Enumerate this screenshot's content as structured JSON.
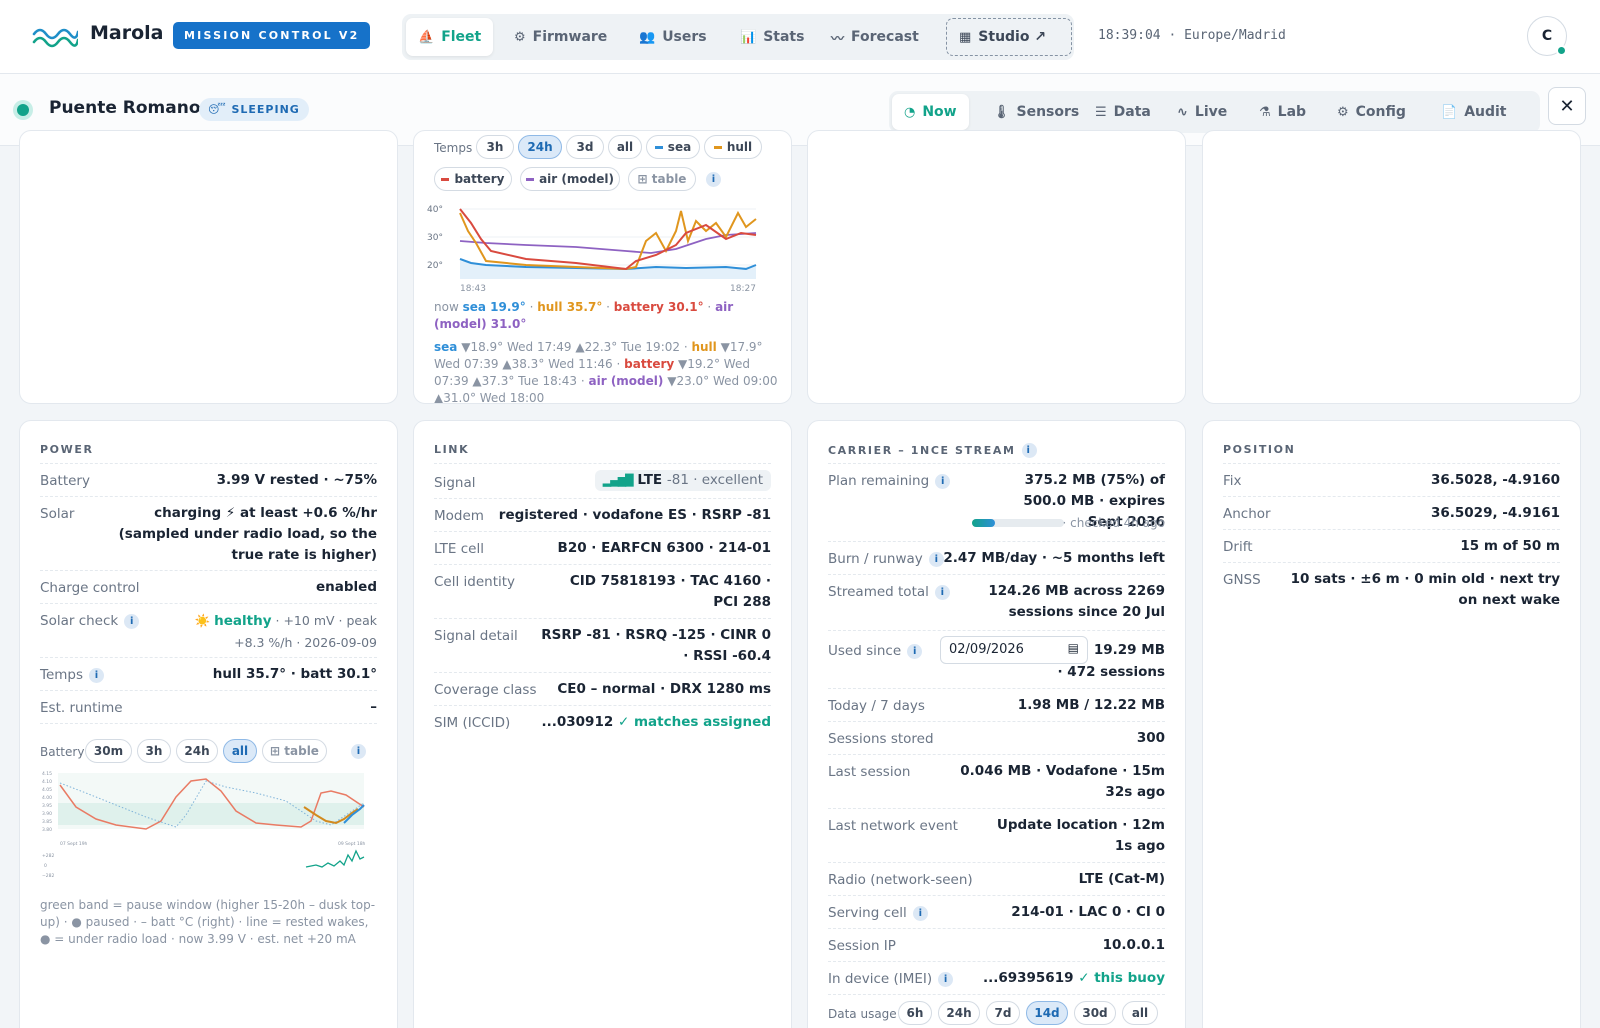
{
  "app": {
    "brand": "Marola",
    "badge": "MISSION CONTROL V2",
    "clock": "18:39:04 · Europe/Madrid",
    "avatar": "C"
  },
  "nav": {
    "fleet": "Fleet",
    "firmware": "Firmware",
    "users": "Users",
    "stats": "Stats",
    "forecast": "Forecast",
    "studio": "Studio ↗"
  },
  "site": {
    "name": "Puente Romano",
    "status": "😴 SLEEPING"
  },
  "tabs": {
    "now": "Now",
    "sensors": "Sensors",
    "data": "Data",
    "live": "Live",
    "lab": "Lab",
    "config": "Config",
    "audit": "Audit"
  },
  "temps": {
    "label": "Temps",
    "ranges": [
      "3h",
      "24h",
      "3d",
      "all"
    ],
    "active": "24h",
    "legend": {
      "sea": "sea",
      "hull": "hull",
      "battery": "battery",
      "air": "air (model)",
      "table": "⊞ table"
    },
    "yticks": [
      "40°",
      "30°",
      "20°"
    ],
    "xticks": [
      "18:43",
      "18:27"
    ],
    "now": {
      "prefix": "now",
      "sea": "sea 19.9°",
      "hull": "hull 35.7°",
      "battery": "battery 30.1°",
      "air": "air (model) 31.0°"
    },
    "sea_range": "▼18.9° Wed 17:49 ▲22.3° Tue 19:02 ·",
    "hull_range": "▼17.9° Wed 07:39 ▲38.3° Wed 11:46 ·",
    "battery_range": "▼19.2° Wed 07:39 ▲37.3° Tue 18:43 ·",
    "air_range": "▼23.0° Wed 09:00 ▲31.0° Wed 18:00"
  },
  "power": {
    "title": "POWER",
    "battery": {
      "label": "Battery",
      "value": "3.99 V rested · ~75%"
    },
    "solar": {
      "label": "Solar",
      "value_strong": "charging ⚡",
      "value_rest": " at least +0.6 %/hr (sampled under radio load, so the true rate is higher)"
    },
    "charge": {
      "label": "Charge control",
      "value": "enabled"
    },
    "solar_check": {
      "label": "Solar check",
      "sun": "☀️",
      "healthy": "healthy",
      "rest": "· +10 mV · peak +8.3 %/h · 2026-09-09"
    },
    "temps": {
      "label": "Temps",
      "value": "hull 35.7° · batt 30.1°"
    },
    "runtime": {
      "label": "Est. runtime",
      "value": "–"
    },
    "chart_label": "Battery",
    "ranges": [
      "30m",
      "3h",
      "24h",
      "all"
    ],
    "active": "all",
    "table": "⊞ table",
    "yticks": [
      "4.15",
      "4.10",
      "4.05",
      "4.00",
      "3.95",
      "3.90",
      "3.85",
      "3.80"
    ],
    "xticks": [
      "07 Sept 19h",
      "09 Sept 18h"
    ],
    "ma": [
      "+282",
      "0",
      "−282"
    ],
    "note": "green band = pause window (higher 15-20h – dusk top-up) · ● paused · – batt °C (right) · line = rested wakes, ● = under radio load · now 3.99 V · est. net +20 mA"
  },
  "link": {
    "title": "LINK",
    "signal": {
      "label": "Signal",
      "tech": "LTE",
      "rest": "-81 · excellent"
    },
    "modem": {
      "label": "Modem",
      "value": "registered · vodafone ES · RSRP -81"
    },
    "cell": {
      "label": "LTE cell",
      "value": "B20 · EARFCN 6300 · 214-01"
    },
    "identity": {
      "label": "Cell identity",
      "value": "CID 75818193 · TAC 4160 · PCI 288"
    },
    "detail": {
      "label": "Signal detail",
      "value": "RSRP -81 · RSRQ -125 · CINR 0 · RSSI -60.4"
    },
    "coverage": {
      "label": "Coverage class",
      "value": "CE0 – normal · DRX 1280 ms"
    },
    "sim": {
      "label": "SIM (ICCID)",
      "value": "...030912",
      "match": "✓ matches assigned"
    }
  },
  "carrier": {
    "title": "CARRIER – 1NCE STREAM",
    "plan": {
      "label": "Plan remaining",
      "value": "375.2 MB (75%) of 500.0 MB · expires Sept 2036",
      "checked": "· checked 4h ago",
      "fraction": 0.25
    },
    "burn": {
      "label": "Burn / runway",
      "value": "2.47 MB/day · ~5 months left"
    },
    "streamed": {
      "label": "Streamed total",
      "value": "124.26 MB across 2269 sessions since 20 Jul"
    },
    "used": {
      "label": "Used since",
      "date": "02/09/2026",
      "value": "19.29 MB",
      "sessions": "· 472 sessions"
    },
    "today": {
      "label": "Today / 7 days",
      "value": "1.98 MB / 12.22 MB"
    },
    "stored": {
      "label": "Sessions stored",
      "value": "300"
    },
    "last": {
      "label": "Last session",
      "value": "0.046 MB · Vodafone · 15m 32s ago"
    },
    "netevent": {
      "label": "Last network event",
      "value": "Update location · 12m 1s ago"
    },
    "radio": {
      "label": "Radio (network-seen)",
      "value": "LTE (Cat-M)"
    },
    "serving": {
      "label": "Serving cell",
      "value": "214-01 · LAC 0 · CI 0"
    },
    "ip": {
      "label": "Session IP",
      "value": "10.0.0.1"
    },
    "imei": {
      "label": "In device (IMEI)",
      "value": "...69395619",
      "match": "✓ this buoy"
    },
    "usage": {
      "label": "Data usage",
      "ranges": [
        "6h",
        "24h",
        "7d",
        "14d",
        "30d",
        "all"
      ],
      "active": "14d"
    }
  },
  "position": {
    "title": "POSITION",
    "fix": {
      "label": "Fix",
      "value": "36.5028, -4.9160"
    },
    "anchor": {
      "label": "Anchor",
      "value": "36.5029, -4.9161"
    },
    "drift": {
      "label": "Drift",
      "value": "15 m of 50 m"
    },
    "gnss": {
      "label": "GNSS",
      "value": "10 sats · ±6 m · 0 min old · next try on next wake"
    }
  },
  "colors": {
    "accent": "#12a38a",
    "sea": "#2f8fd8",
    "hull": "#e0961e",
    "battery": "#d94a3f",
    "air": "#8e62c2"
  }
}
